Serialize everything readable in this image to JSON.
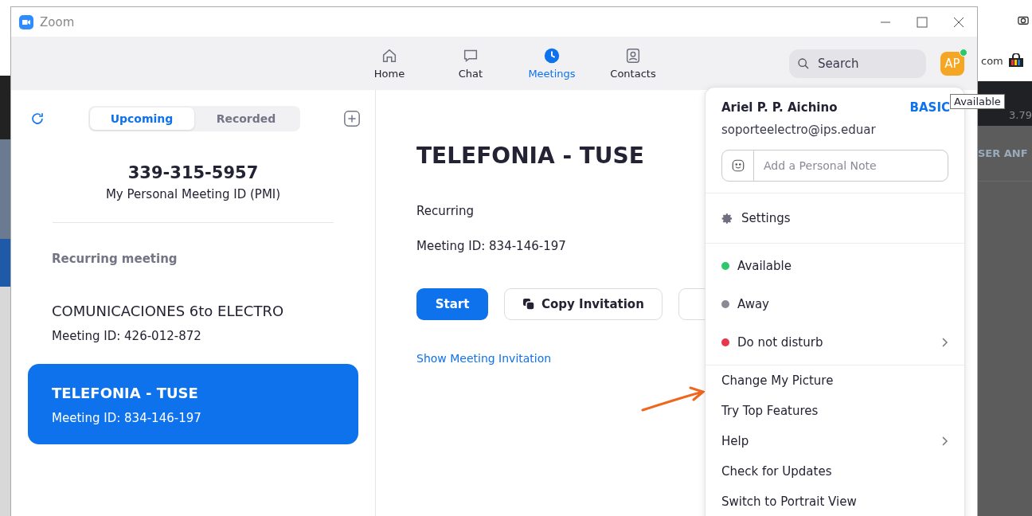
{
  "window": {
    "title": "Zoom"
  },
  "nav": {
    "tabs": [
      {
        "label": "Home",
        "selected": false
      },
      {
        "label": "Chat",
        "selected": false
      },
      {
        "label": "Meetings",
        "selected": true
      },
      {
        "label": "Contacts",
        "selected": false
      }
    ],
    "search": {
      "placeholder": "Search"
    },
    "avatar": {
      "initials": "AP",
      "online": true
    },
    "tooltip": "Available"
  },
  "sidebar": {
    "segments": [
      {
        "label": "Upcoming",
        "selected": true
      },
      {
        "label": "Recorded",
        "selected": false
      }
    ],
    "pmi": {
      "number": "339-315-5957",
      "label": "My Personal Meeting ID (PMI)"
    },
    "section_heading": "Recurring meeting",
    "meetings": [
      {
        "title": "COMUNICACIONES 6to ELECTRO",
        "meeting_id": "Meeting ID: 426-012-872",
        "selected": false
      },
      {
        "title": "TELEFONIA - TUSE",
        "meeting_id": "Meeting ID: 834-146-197",
        "selected": true
      }
    ]
  },
  "detail": {
    "title": "TELEFONIA - TUSE",
    "type": "Recurring",
    "meeting_id": "Meeting ID: 834-146-197",
    "buttons": [
      {
        "kind": "primary",
        "label": "Start"
      },
      {
        "kind": "copy",
        "label": "Copy Invitation"
      },
      {
        "kind": "edit"
      }
    ],
    "link": "Show Meeting Invitation"
  },
  "profile_menu": {
    "name": "Ariel P. P. Aichino",
    "plan": "BASIC",
    "email": "soporteelectro@ips.eduar",
    "note_placeholder": "Add a Personal Note",
    "groups": [
      [
        {
          "kind": "settings",
          "label": "Settings",
          "submenu": false
        }
      ],
      [
        {
          "kind": "status",
          "label": "Available",
          "color": "#2dc76d",
          "submenu": false
        },
        {
          "kind": "status",
          "label": "Away",
          "color": "#8a8a96",
          "submenu": false
        },
        {
          "kind": "status",
          "label": "Do not disturb",
          "color": "#e8364d",
          "submenu": true
        }
      ],
      [
        {
          "kind": "plain",
          "label": "Change My Picture",
          "submenu": false
        },
        {
          "kind": "plain",
          "label": "Try Top Features",
          "submenu": false
        },
        {
          "kind": "plain",
          "label": "Help",
          "submenu": true
        },
        {
          "kind": "plain",
          "label": "Check for Updates",
          "submenu": false
        },
        {
          "kind": "plain",
          "label": "Switch to Portrait View",
          "submenu": false
        }
      ]
    ]
  },
  "browser_behind": {
    "address_fragment": "com",
    "price_fragment": "3.79",
    "heading_fragment": "SER ANF"
  }
}
